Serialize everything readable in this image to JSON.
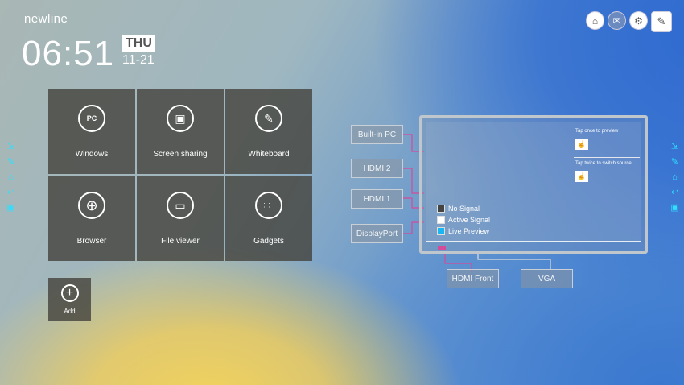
{
  "brand": "newline",
  "clock": {
    "time": "06:51",
    "day": "THU",
    "date": "11-21"
  },
  "top_icons": [
    "usb-icon",
    "mail-icon",
    "settings-icon",
    "notes-icon"
  ],
  "tiles": [
    {
      "label": "Windows",
      "icon": "PC"
    },
    {
      "label": "Screen sharing",
      "icon": "▣"
    },
    {
      "label": "Whiteboard",
      "icon": "✎"
    },
    {
      "label": "Browser",
      "icon": "⊕"
    },
    {
      "label": "File viewer",
      "icon": "▭"
    },
    {
      "label": "Gadgets",
      "icon": "⋮⋮⋮"
    }
  ],
  "add_tile": {
    "label": "Add",
    "icon": "+"
  },
  "side_icons": [
    "input-icon",
    "pen-icon",
    "home-icon",
    "back-icon",
    "display-icon"
  ],
  "sources": {
    "builtin_pc": "Built-in PC",
    "hdmi2": "HDMI 2",
    "hdmi1": "HDMI 1",
    "displayport": "DisplayPort",
    "hdmi_front": "HDMI Front",
    "vga": "VGA"
  },
  "hints": {
    "preview": "Tap once to preview",
    "switch": "Tap twice to switch source"
  },
  "legend": [
    {
      "label": "No Signal",
      "color": "#444444"
    },
    {
      "label": "Active Signal",
      "color": "#ffffff"
    },
    {
      "label": "Live Preview",
      "color": "#19b6f2"
    }
  ],
  "colors": {
    "accent_cyan": "#2de0ff",
    "wire_magenta": "#d44b9a",
    "tile_bg": "#46443e"
  }
}
